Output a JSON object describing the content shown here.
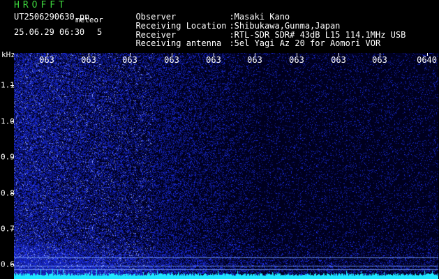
{
  "header": {
    "app_title": "HROFFT",
    "filename": "UT2506290630.pn",
    "detect_label": "meteor",
    "timestamp": "25.06.29 06:30",
    "count": "5"
  },
  "station": [
    {
      "label": "Observer",
      "value": ":Masaki Kano"
    },
    {
      "label": "Receiving Location",
      "value": ":Shibukawa,Gunma,Japan"
    },
    {
      "label": "Receiver",
      "value": ":RTL-SDR SDR# 43dB L15 114.1MHz USB"
    },
    {
      "label": "Receiving antenna",
      "value": ":5el Yagi Az 20 for Aomori VOR"
    }
  ],
  "spectrogram": {
    "unit": "kHz",
    "time_ticks": [
      "063",
      "063",
      "063",
      "063",
      "063",
      "063",
      "063",
      "063",
      "063",
      "0640"
    ],
    "freq_ticks": [
      {
        "label": "1.1",
        "value": 1.1
      },
      {
        "label": "1.0",
        "value": 1.0
      },
      {
        "label": "0.9",
        "value": 0.9
      },
      {
        "label": "0.8",
        "value": 0.8
      },
      {
        "label": "0.7",
        "value": 0.7
      },
      {
        "label": "0.6",
        "value": 0.6
      }
    ],
    "freq_range": [
      0.56,
      1.19
    ],
    "colors": {
      "background": "#00001e",
      "noise": "#2a3cff",
      "bright_noise": "#8aa0ff",
      "reference_line": "#7fa8ff",
      "baseline": "#1ee6ff"
    }
  }
}
